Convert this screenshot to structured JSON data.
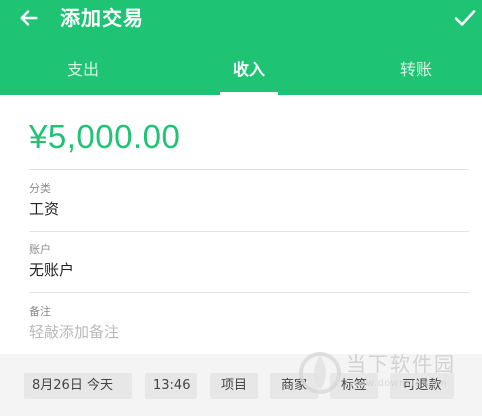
{
  "header": {
    "title": "添加交易",
    "back_icon": "arrow-left-icon",
    "confirm_icon": "check-icon",
    "background": "#1ec373"
  },
  "tabs": [
    {
      "label": "支出",
      "active": false
    },
    {
      "label": "收入",
      "active": true
    },
    {
      "label": "转账",
      "active": false
    }
  ],
  "form": {
    "amount": "¥5,000.00",
    "amount_color": "#1ec373",
    "category": {
      "label": "分类",
      "value": "工资"
    },
    "account": {
      "label": "账户",
      "value": "无账户"
    },
    "note": {
      "label": "备注",
      "placeholder": "轻敲添加备注"
    }
  },
  "chips": {
    "date": "8月26日  今天",
    "time": "13:46",
    "project": "项目",
    "merchant": "商家",
    "tag": "标签",
    "refund": "可退款"
  },
  "watermark": {
    "text": "当下软件园",
    "url": "www.downxia.com"
  }
}
